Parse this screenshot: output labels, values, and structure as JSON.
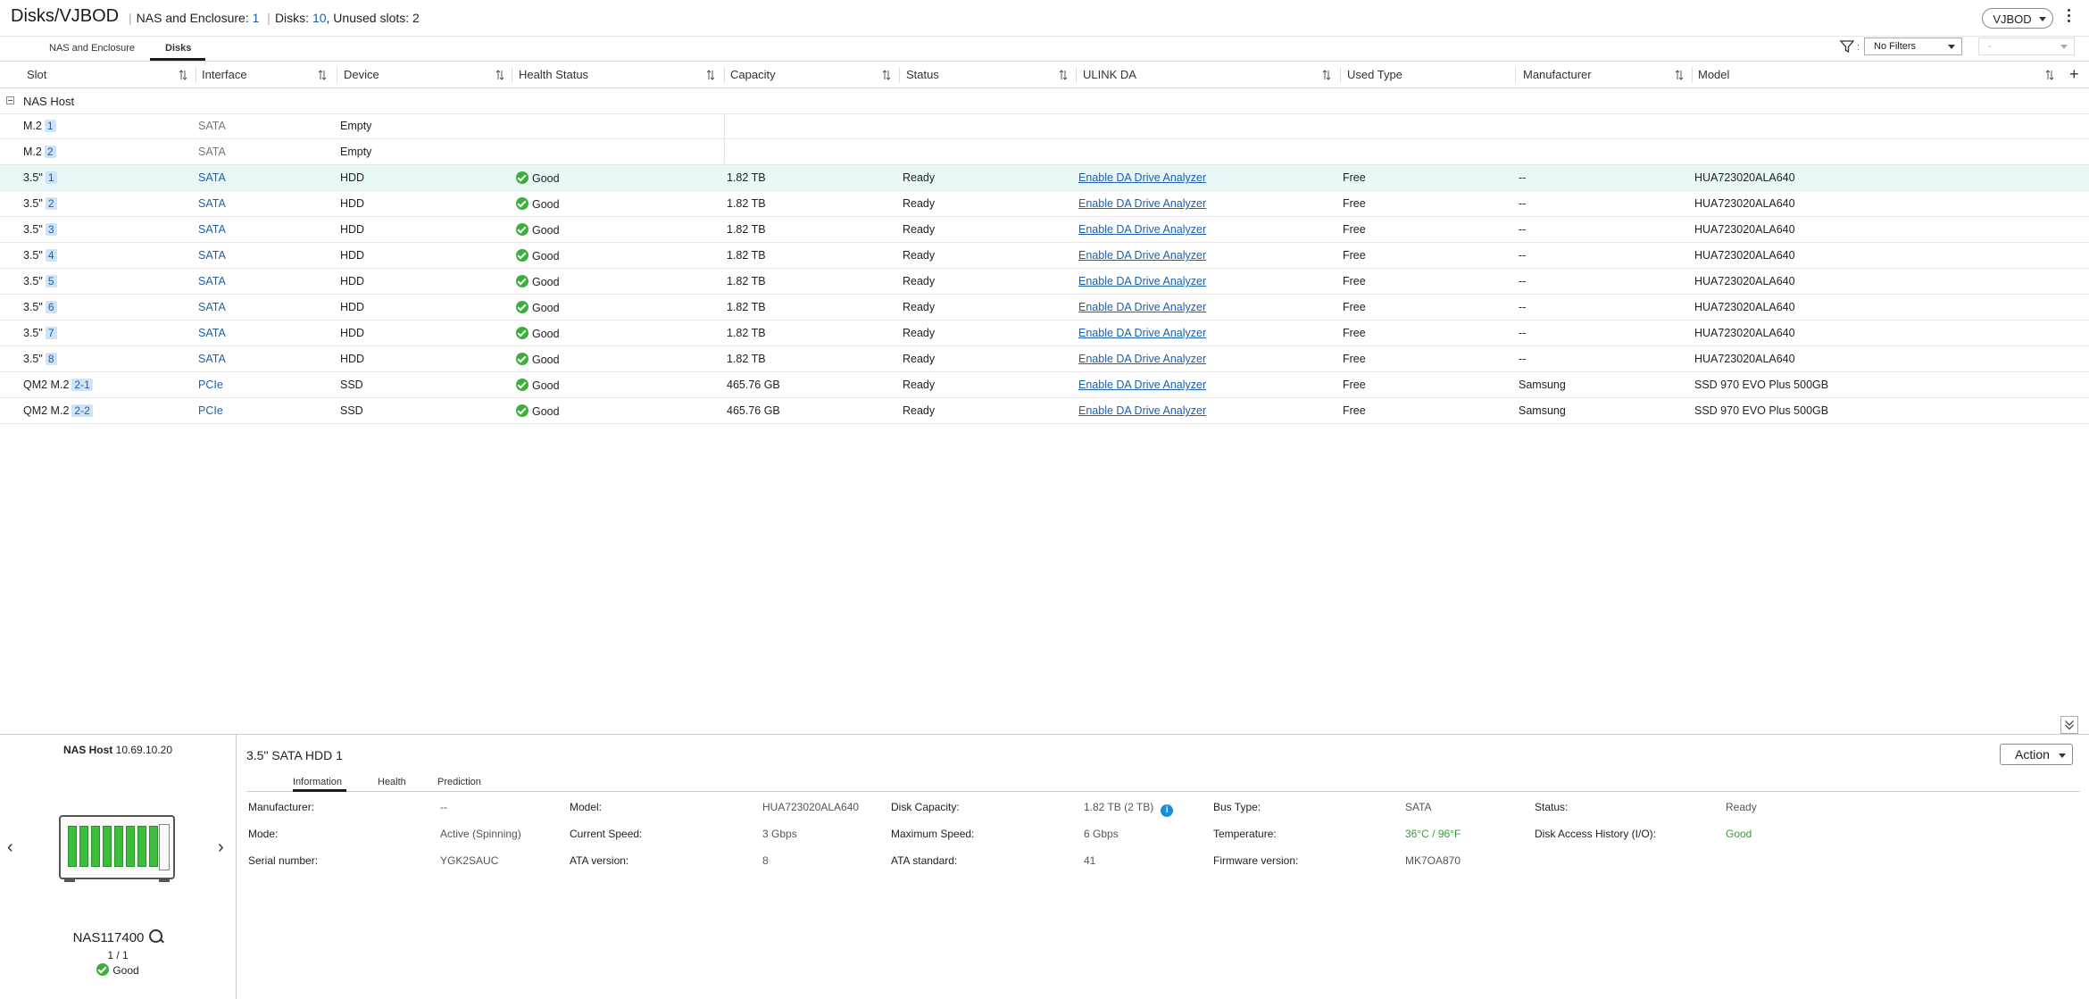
{
  "header": {
    "title": "Disks/VJBOD",
    "nas_label": "NAS and Enclosure:",
    "nas_count": "1",
    "disks_label": "Disks:",
    "disks_count": "10",
    "unused_label": ", Unused slots:",
    "unused_count": "2",
    "vjbod_button": "VJBOD"
  },
  "tabs": [
    "NAS and Enclosure",
    "Disks"
  ],
  "filter": {
    "selected": "No Filters",
    "secondary": "-"
  },
  "columns": [
    "Slot",
    "Interface",
    "Device",
    "Health Status",
    "Capacity",
    "Status",
    "ULINK DA",
    "Used Type",
    "Manufacturer",
    "Model"
  ],
  "group": "NAS Host",
  "rows": [
    {
      "slot_prefix": "M.2",
      "slot_num": "1",
      "interface": "SATA",
      "device": "Empty",
      "health": "",
      "capacity": "",
      "status": "",
      "ulink": "",
      "used": "",
      "manufacturer": "",
      "model": ""
    },
    {
      "slot_prefix": "M.2",
      "slot_num": "2",
      "interface": "SATA",
      "device": "Empty",
      "health": "",
      "capacity": "",
      "status": "",
      "ulink": "",
      "used": "",
      "manufacturer": "",
      "model": ""
    },
    {
      "slot_prefix": "3.5\"",
      "slot_num": "1",
      "interface": "SATA",
      "device": "HDD",
      "health": "Good",
      "capacity": "1.82 TB",
      "status": "Ready",
      "ulink": "Enable DA Drive Analyzer",
      "used": "Free",
      "manufacturer": "--",
      "model": "HUA723020ALA640"
    },
    {
      "slot_prefix": "3.5\"",
      "slot_num": "2",
      "interface": "SATA",
      "device": "HDD",
      "health": "Good",
      "capacity": "1.82 TB",
      "status": "Ready",
      "ulink": "Enable DA Drive Analyzer",
      "used": "Free",
      "manufacturer": "--",
      "model": "HUA723020ALA640"
    },
    {
      "slot_prefix": "3.5\"",
      "slot_num": "3",
      "interface": "SATA",
      "device": "HDD",
      "health": "Good",
      "capacity": "1.82 TB",
      "status": "Ready",
      "ulink": "Enable DA Drive Analyzer",
      "used": "Free",
      "manufacturer": "--",
      "model": "HUA723020ALA640"
    },
    {
      "slot_prefix": "3.5\"",
      "slot_num": "4",
      "interface": "SATA",
      "device": "HDD",
      "health": "Good",
      "capacity": "1.82 TB",
      "status": "Ready",
      "ulink": "Enable DA Drive Analyzer",
      "used": "Free",
      "manufacturer": "--",
      "model": "HUA723020ALA640"
    },
    {
      "slot_prefix": "3.5\"",
      "slot_num": "5",
      "interface": "SATA",
      "device": "HDD",
      "health": "Good",
      "capacity": "1.82 TB",
      "status": "Ready",
      "ulink": "Enable DA Drive Analyzer",
      "used": "Free",
      "manufacturer": "--",
      "model": "HUA723020ALA640"
    },
    {
      "slot_prefix": "3.5\"",
      "slot_num": "6",
      "interface": "SATA",
      "device": "HDD",
      "health": "Good",
      "capacity": "1.82 TB",
      "status": "Ready",
      "ulink": "Enable DA Drive Analyzer",
      "used": "Free",
      "manufacturer": "--",
      "model": "HUA723020ALA640"
    },
    {
      "slot_prefix": "3.5\"",
      "slot_num": "7",
      "interface": "SATA",
      "device": "HDD",
      "health": "Good",
      "capacity": "1.82 TB",
      "status": "Ready",
      "ulink": "Enable DA Drive Analyzer",
      "used": "Free",
      "manufacturer": "--",
      "model": "HUA723020ALA640"
    },
    {
      "slot_prefix": "3.5\"",
      "slot_num": "8",
      "interface": "SATA",
      "device": "HDD",
      "health": "Good",
      "capacity": "1.82 TB",
      "status": "Ready",
      "ulink": "Enable DA Drive Analyzer",
      "used": "Free",
      "manufacturer": "--",
      "model": "HUA723020ALA640"
    },
    {
      "slot_prefix": "QM2 M.2",
      "slot_num": "2-1",
      "interface": "PCIe",
      "device": "SSD",
      "health": "Good",
      "capacity": "465.76 GB",
      "status": "Ready",
      "ulink": "Enable DA Drive Analyzer",
      "used": "Free",
      "manufacturer": "Samsung",
      "model": "SSD 970 EVO Plus 500GB"
    },
    {
      "slot_prefix": "QM2 M.2",
      "slot_num": "2-2",
      "interface": "PCIe",
      "device": "SSD",
      "health": "Good",
      "capacity": "465.76 GB",
      "status": "Ready",
      "ulink": "Enable DA Drive Analyzer",
      "used": "Free",
      "manufacturer": "Samsung",
      "model": "SSD 970 EVO Plus 500GB"
    }
  ],
  "left_panel": {
    "host_label": "NAS Host",
    "host_ip": "10.69.10.20",
    "nas_name": "NAS117400",
    "page": "1 / 1",
    "status": "Good"
  },
  "detail": {
    "title": "3.5\" SATA HDD 1",
    "action": "Action",
    "tabs": [
      "Information",
      "Health",
      "Prediction"
    ],
    "info": [
      {
        "label": "Manufacturer:",
        "value": "--"
      },
      {
        "label": "Model:",
        "value": "HUA723020ALA640"
      },
      {
        "label": "Disk Capacity:",
        "value": "1.82 TB (2 TB)"
      },
      {
        "label": "Bus Type:",
        "value": "SATA"
      },
      {
        "label": "Status:",
        "value": "Ready"
      },
      {
        "label": "Mode:",
        "value": "Active (Spinning)"
      },
      {
        "label": "Current Speed:",
        "value": "3 Gbps"
      },
      {
        "label": "Maximum Speed:",
        "value": "6 Gbps"
      },
      {
        "label": "Temperature:",
        "value": "36°C / 96°F"
      },
      {
        "label": "Disk Access History (I/O):",
        "value": "Good"
      },
      {
        "label": "Serial number:",
        "value": "YGK2SAUC"
      },
      {
        "label": "ATA version:",
        "value": "8"
      },
      {
        "label": "ATA standard:",
        "value": "41"
      },
      {
        "label": "Firmware version:",
        "value": "MK7OA870"
      }
    ],
    "info_icon": "i"
  },
  "colors": {
    "accent": "#1c5fae",
    "good": "#3cae3c",
    "selected_row": "#e9f7f7"
  }
}
